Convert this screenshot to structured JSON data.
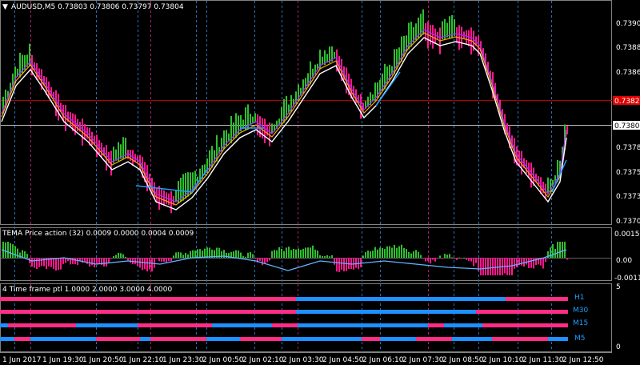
{
  "symbol_bar": {
    "dropdown_icon": "triangle-down-icon",
    "text": "AUDUSD,M5  0.73803 0.73806 0.73797 0.73804"
  },
  "main_panel": {
    "price_labels": [
      "0.73901",
      "0.73882",
      "0.73862",
      "0.73822",
      "0.73782",
      "0.73757",
      "0.73732",
      "0.73707"
    ],
    "bid_label": "0.73804",
    "level_label": "0.73823",
    "colors": {
      "bull": "#2fbf2f",
      "bear": "#ff1a8c",
      "tema_up": "#ffffff",
      "tema_down": "#1ea0ff",
      "ma1": "#ffa500",
      "ma2": "#a02cff",
      "level": "#b00000"
    }
  },
  "tema_panel": {
    "title": "TEMA Price action (32) 0.0009 0.0000 0.0004 0.0009",
    "scale_labels": [
      "0.0015",
      "0.00",
      "-0.0011"
    ]
  },
  "mtf_panel": {
    "title": "4 Time frame ptl 1.0000 2.0000 3.0000 4.0000",
    "scale_labels": [
      "5",
      "0"
    ],
    "rows": [
      {
        "label": "H1",
        "segments": [
          [
            "pink",
            0,
            370
          ],
          [
            "blue",
            370,
            632
          ],
          [
            "pink",
            632,
            710
          ]
        ]
      },
      {
        "label": "M30",
        "segments": [
          [
            "pink",
            0,
            370
          ],
          [
            "blue",
            370,
            595
          ],
          [
            "pink",
            595,
            710
          ]
        ]
      },
      {
        "label": "M15",
        "segments": [
          [
            "blue",
            0,
            10
          ],
          [
            "pink",
            10,
            95
          ],
          [
            "blue",
            95,
            172
          ],
          [
            "pink",
            172,
            265
          ],
          [
            "blue",
            265,
            340
          ],
          [
            "pink",
            340,
            372
          ],
          [
            "blue",
            372,
            535
          ],
          [
            "pink",
            535,
            555
          ],
          [
            "blue",
            555,
            603
          ],
          [
            "pink",
            603,
            710
          ]
        ]
      },
      {
        "label": "M5",
        "segments": [
          [
            "blue",
            0,
            18
          ],
          [
            "pink",
            18,
            38
          ],
          [
            "blue",
            38,
            120
          ],
          [
            "pink",
            120,
            175
          ],
          [
            "blue",
            175,
            188
          ],
          [
            "pink",
            188,
            258
          ],
          [
            "blue",
            258,
            300
          ],
          [
            "pink",
            300,
            352
          ],
          [
            "blue",
            352,
            452
          ],
          [
            "pink",
            452,
            475
          ],
          [
            "blue",
            475,
            520
          ],
          [
            "pink",
            520,
            565
          ],
          [
            "blue",
            565,
            615
          ],
          [
            "pink",
            615,
            685
          ],
          [
            "blue",
            685,
            710
          ]
        ]
      }
    ]
  },
  "time_labels": [
    "1 Jun 2017",
    "1 Jun 19:30",
    "1 Jun 20:50",
    "1 Jun 22:10",
    "1 Jun 23:30",
    "2 Jun 00:50",
    "2 Jun 02:10",
    "2 Jun 03:30",
    "2 Jun 04:50",
    "2 Jun 06:10",
    "2 Jun 07:30",
    "2 Jun 08:50",
    "2 Jun 10:10",
    "2 Jun 11:30",
    "2 Jun 12:50"
  ]
}
